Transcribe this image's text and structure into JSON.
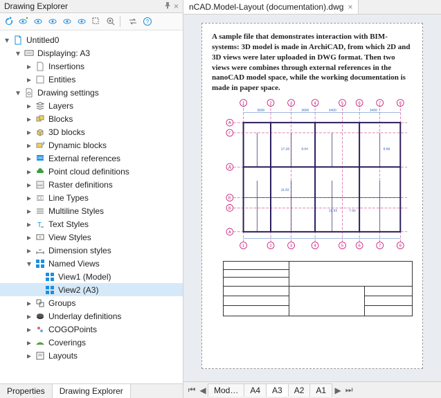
{
  "panel": {
    "title": "Drawing Explorer",
    "tabs": {
      "properties": "Properties",
      "explorer": "Drawing Explorer"
    }
  },
  "tree": {
    "root": "Untitled0",
    "displaying": "Displaying: A3",
    "insertions": "Insertions",
    "entities": "Entities",
    "settings": "Drawing settings",
    "layers": "Layers",
    "blocks": "Blocks",
    "blocks3d": "3D blocks",
    "dynblocks": "Dynamic blocks",
    "xrefs": "External references",
    "pointcloud": "Point cloud definitions",
    "raster": "Raster definitions",
    "linetypes": "Line Types",
    "mlstyles": "Multiline Styles",
    "textstyles": "Text Styles",
    "viewstyles": "View Styles",
    "dimstyles": "Dimension styles",
    "namedviews": "Named Views",
    "view1": "View1 (Model)",
    "view2": "View2 (A3)",
    "groups": "Groups",
    "underlay": "Underlay definitions",
    "cogo": "COGOPoints",
    "coverings": "Coverings",
    "layouts": "Layouts"
  },
  "doc": {
    "tab": "nCAD.Model-Layout (documentation).dwg",
    "paragraph": "A sample file that demonstrates interaction with BIM-systems: 3D model is made in ArchiCAD, from which 2D and 3D views were later uploaded in DWG format. Then two views were combines through external references in the nanoCAD model space, while the working documentation is made in paper space."
  },
  "layout_tabs": {
    "model": "Mod…",
    "a4": "A4",
    "a3": "A3",
    "a2": "A2",
    "a1": "A1"
  },
  "colors": {
    "accent": "#1a8fe3",
    "grid_axis": "#c30b6e",
    "dim_blue": "#1551a8"
  }
}
